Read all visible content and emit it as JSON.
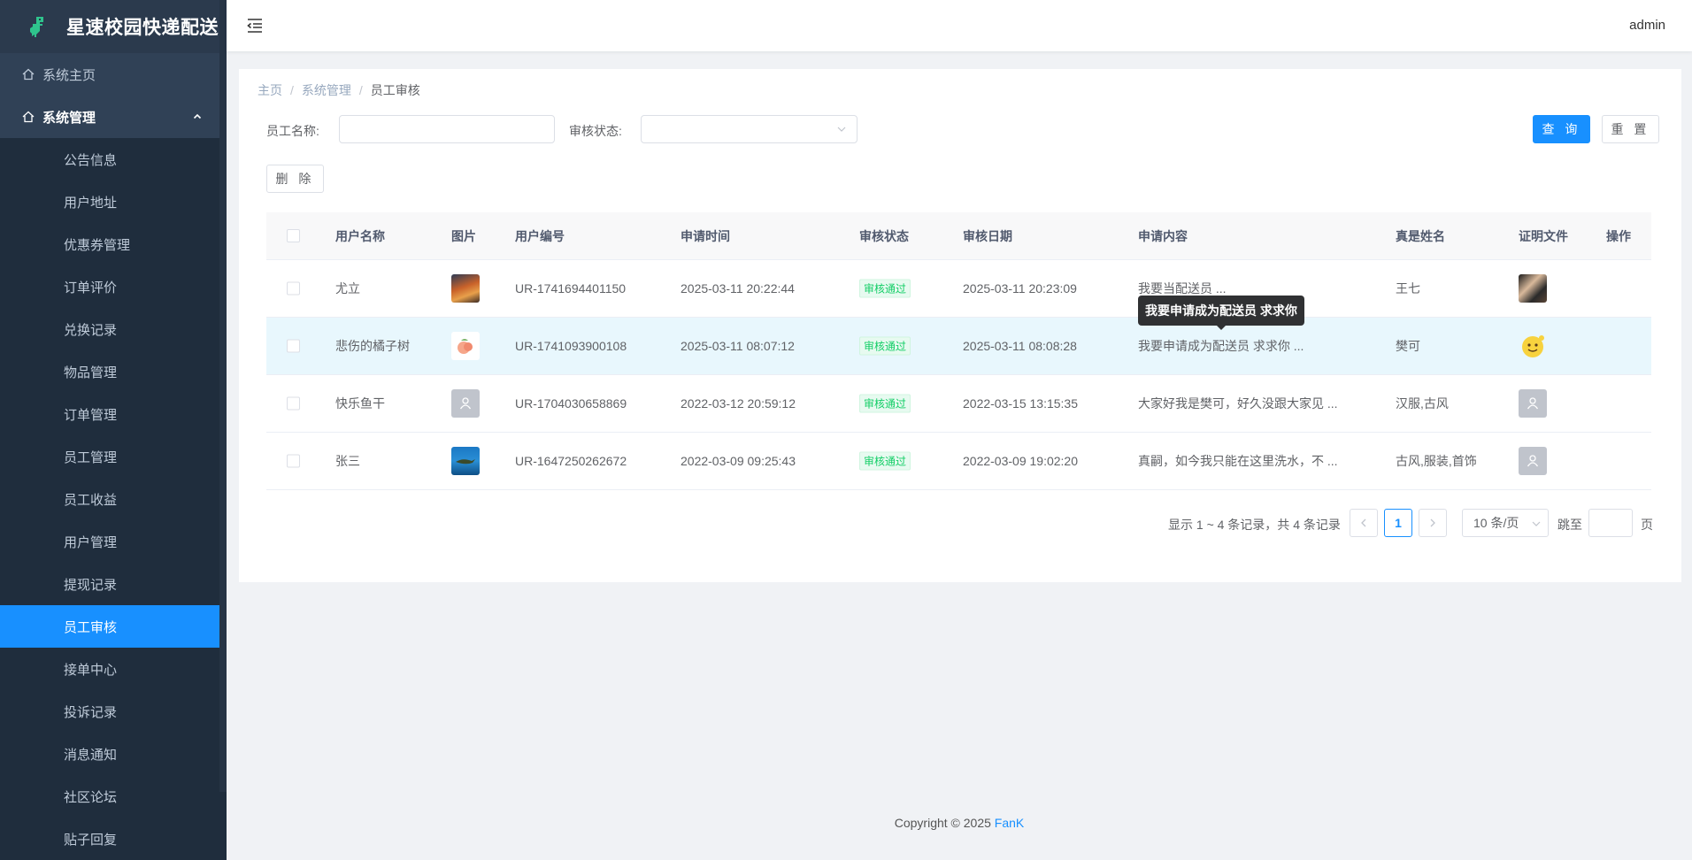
{
  "app": {
    "title": "星速校园快递配送",
    "user": "admin"
  },
  "sidebar": {
    "home": "系统主页",
    "group": "系统管理",
    "items": [
      "公告信息",
      "用户地址",
      "优惠券管理",
      "订单评价",
      "兑换记录",
      "物品管理",
      "订单管理",
      "员工管理",
      "员工收益",
      "用户管理",
      "提现记录",
      "员工审核",
      "接单中心",
      "投诉记录",
      "消息通知",
      "社区论坛",
      "贴子回复"
    ],
    "active": "员工审核"
  },
  "breadcrumb": [
    "主页",
    "系统管理",
    "员工审核"
  ],
  "search": {
    "name_label": "员工名称:",
    "name_value": "",
    "status_label": "审核状态:",
    "status_value": "",
    "query_btn": "查 询",
    "reset_btn": "重 置"
  },
  "toolbar": {
    "delete_btn": "删 除"
  },
  "table": {
    "headers": [
      "用户名称",
      "图片",
      "用户编号",
      "申请时间",
      "审核状态",
      "审核日期",
      "申请内容",
      "真是姓名",
      "证明文件",
      "操作"
    ],
    "rows": [
      {
        "name": "尤立",
        "image": "photo-landscape",
        "code": "UR-1741694401150",
        "apply_time": "2025-03-11 20:22:44",
        "status": "审核通过",
        "audit_date": "2025-03-11 20:23:09",
        "content": "我要当配送员 ...",
        "real_name": "王七",
        "proof": "photo-person"
      },
      {
        "name": "悲伤的橘子树",
        "image": "photo-peach",
        "code": "UR-1741093900108",
        "apply_time": "2025-03-11 08:07:12",
        "status": "审核通过",
        "audit_date": "2025-03-11 08:08:28",
        "content": "我要申请成为配送员 求求你 ...",
        "real_name": "樊可",
        "proof": "photo-emoji"
      },
      {
        "name": "快乐鱼干",
        "image": "placeholder-avatar",
        "code": "UR-1704030658869",
        "apply_time": "2022-03-12 20:59:12",
        "status": "审核通过",
        "audit_date": "2022-03-15 13:15:35",
        "content": "大家好我是樊可，好久没跟大家见 ...",
        "real_name": "汉服,古风",
        "proof": "placeholder-avatar"
      },
      {
        "name": "张三",
        "image": "photo-ocean",
        "code": "UR-1647250262672",
        "apply_time": "2022-03-09 09:25:43",
        "status": "审核通过",
        "audit_date": "2022-03-09 19:02:20",
        "content": "真嗣，如今我只能在这里洗水，不 ...",
        "real_name": "古风,服装,首饰",
        "proof": "placeholder-avatar"
      }
    ]
  },
  "tooltip": "我要申请成为配送员 求求你",
  "pagination": {
    "summary": "显示 1 ~ 4 条记录，共 4 条记录",
    "current": "1",
    "page_size": "10 条/页",
    "jump_label": "跳至",
    "page_unit": "页"
  },
  "footer": {
    "text": "Copyright © 2025 ",
    "author": "FanK"
  },
  "colors": {
    "primary": "#1890ff",
    "sidebar": "#304156",
    "success": "#13ce66"
  }
}
